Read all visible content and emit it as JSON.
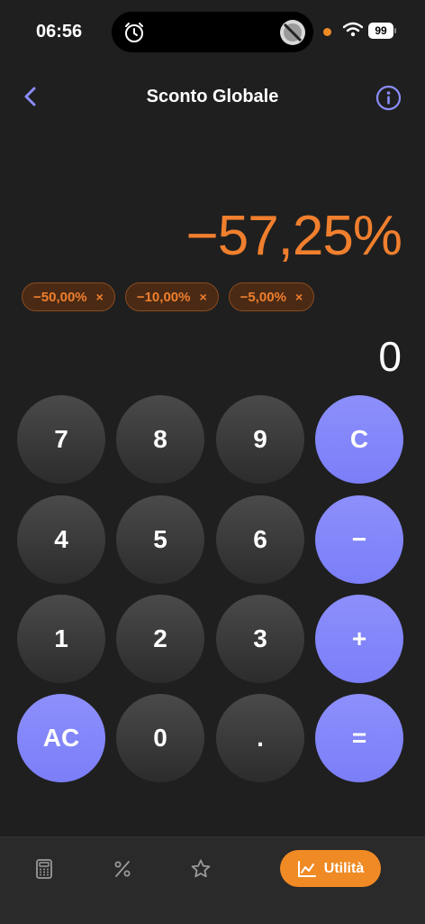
{
  "status_bar": {
    "time": "06:56",
    "battery": "99"
  },
  "header": {
    "title": "Sconto Globale"
  },
  "display": {
    "result": "−57,25%",
    "chips": [
      {
        "label": "−50,00%",
        "remove": "×"
      },
      {
        "label": "−10,00%",
        "remove": "×"
      },
      {
        "label": "−5,00%",
        "remove": "×"
      }
    ],
    "input": "0"
  },
  "keypad": {
    "rows": [
      [
        "7",
        "8",
        "9",
        "C"
      ],
      [
        "4",
        "5",
        "6",
        "−"
      ],
      [
        "1",
        "2",
        "3",
        "+"
      ],
      [
        "AC",
        "0",
        ".",
        "="
      ]
    ]
  },
  "tab_bar": {
    "icons": [
      "calculator-icon",
      "percent-icon",
      "star-icon",
      "chart-icon"
    ],
    "active_label": "Utilità"
  },
  "colors": {
    "background": "#1f1f1f",
    "accent_orange": "#f08a24",
    "result_orange": "#f07f2e",
    "operator_purple": "#7b7ef8"
  }
}
